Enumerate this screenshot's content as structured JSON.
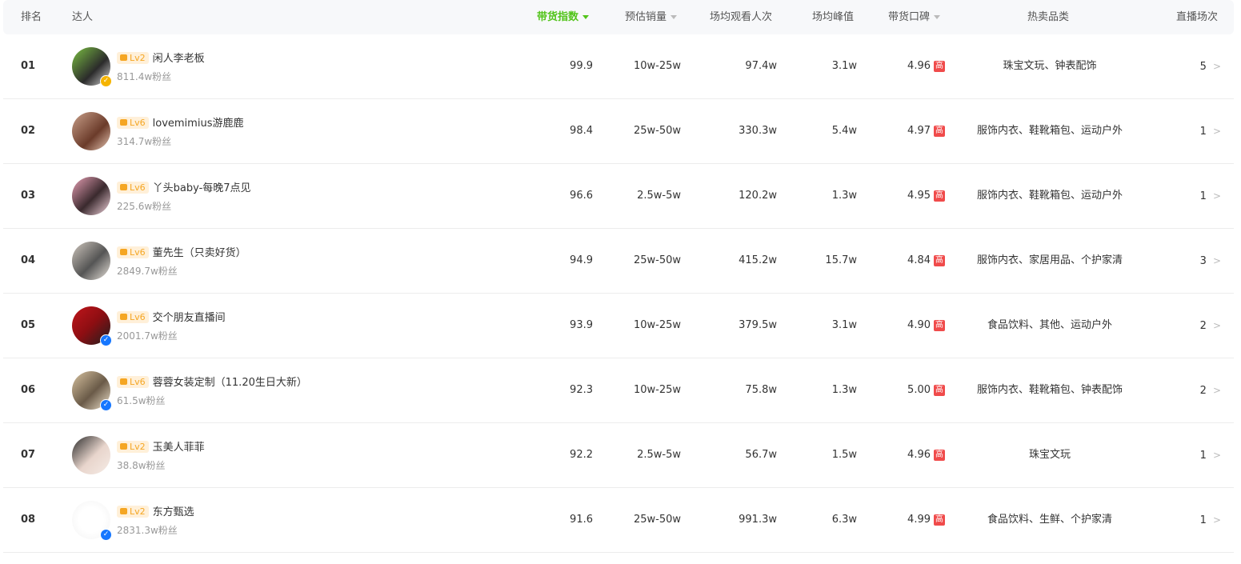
{
  "header": {
    "rank": "排名",
    "influencer": "达人",
    "sales_index": "带货指数",
    "est_sales": "预估销量",
    "avg_viewers": "场均观看人次",
    "avg_peak": "场均峰值",
    "reputation": "带货口碑",
    "hot_categories": "热卖品类",
    "live_count": "直播场次"
  },
  "colors": {
    "accent": "#52c41a",
    "level_badge": "#f5a623",
    "high_badge": "#f04b4b",
    "verify_blue": "#1677ff",
    "verify_gold": "#f5b400"
  },
  "rows": [
    {
      "rank": "01",
      "level": "Lv2",
      "name": "闲人李老板",
      "fans": "811.4w粉丝",
      "index": "99.9",
      "sales": "10w-25w",
      "viewers": "97.4w",
      "peak": "3.1w",
      "reputation": "4.96",
      "rep_tag": "高",
      "categories": "珠宝文玩、钟表配饰",
      "lives": "5",
      "badge": "gold"
    },
    {
      "rank": "02",
      "level": "Lv6",
      "name": "lovemimius游鹿鹿",
      "fans": "314.7w粉丝",
      "index": "98.4",
      "sales": "25w-50w",
      "viewers": "330.3w",
      "peak": "5.4w",
      "reputation": "4.97",
      "rep_tag": "高",
      "categories": "服饰内衣、鞋靴箱包、运动户外",
      "lives": "1",
      "badge": ""
    },
    {
      "rank": "03",
      "level": "Lv6",
      "name": "丫头baby-每晚7点见",
      "fans": "225.6w粉丝",
      "index": "96.6",
      "sales": "2.5w-5w",
      "viewers": "120.2w",
      "peak": "1.3w",
      "reputation": "4.95",
      "rep_tag": "高",
      "categories": "服饰内衣、鞋靴箱包、运动户外",
      "lives": "1",
      "badge": ""
    },
    {
      "rank": "04",
      "level": "Lv6",
      "name": "董先生（只卖好货）",
      "fans": "2849.7w粉丝",
      "index": "94.9",
      "sales": "25w-50w",
      "viewers": "415.2w",
      "peak": "15.7w",
      "reputation": "4.84",
      "rep_tag": "高",
      "categories": "服饰内衣、家居用品、个护家清",
      "lives": "3",
      "badge": ""
    },
    {
      "rank": "05",
      "level": "Lv6",
      "name": "交个朋友直播间",
      "fans": "2001.7w粉丝",
      "index": "93.9",
      "sales": "10w-25w",
      "viewers": "379.5w",
      "peak": "3.1w",
      "reputation": "4.90",
      "rep_tag": "高",
      "categories": "食品饮料、其他、运动户外",
      "lives": "2",
      "badge": "blue"
    },
    {
      "rank": "06",
      "level": "Lv6",
      "name": "蓉蓉女装定制（11.20生日大新）",
      "fans": "61.5w粉丝",
      "index": "92.3",
      "sales": "10w-25w",
      "viewers": "75.8w",
      "peak": "1.3w",
      "reputation": "5.00",
      "rep_tag": "高",
      "categories": "服饰内衣、鞋靴箱包、钟表配饰",
      "lives": "2",
      "badge": "blue"
    },
    {
      "rank": "07",
      "level": "Lv2",
      "name": "玉美人菲菲",
      "fans": "38.8w粉丝",
      "index": "92.2",
      "sales": "2.5w-5w",
      "viewers": "56.7w",
      "peak": "1.5w",
      "reputation": "4.96",
      "rep_tag": "高",
      "categories": "珠宝文玩",
      "lives": "1",
      "badge": ""
    },
    {
      "rank": "08",
      "level": "Lv2",
      "name": "东方甄选",
      "fans": "2831.3w粉丝",
      "index": "91.6",
      "sales": "25w-50w",
      "viewers": "991.3w",
      "peak": "6.3w",
      "reputation": "4.99",
      "rep_tag": "高",
      "categories": "食品饮料、生鲜、个护家清",
      "lives": "1",
      "badge": "blue"
    }
  ]
}
